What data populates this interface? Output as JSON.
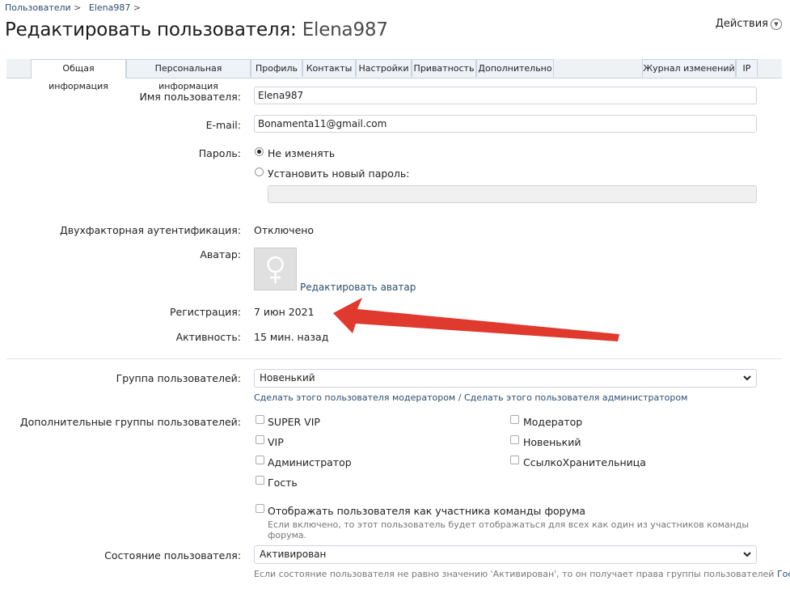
{
  "breadcrumb": {
    "items": [
      "Пользователи",
      "Elena987"
    ]
  },
  "page": {
    "title_prefix": "Редактировать пользователя: ",
    "title_user": "Elena987"
  },
  "actions": {
    "label": "Действия"
  },
  "tabs": {
    "left": [
      "Общая информация",
      "Персональная информация",
      "Профиль",
      "Контакты",
      "Настройки",
      "Приватность",
      "Дополнительно"
    ],
    "right": [
      "Журнал изменений",
      "IP"
    ],
    "active": "Общая информация"
  },
  "form": {
    "username": {
      "label": "Имя пользователя:",
      "value": "Elena987"
    },
    "email": {
      "label": "E-mail:",
      "value": "Bonamenta11@gmail.com"
    },
    "password": {
      "label": "Пароль:",
      "opt_keep": "Не изменять",
      "opt_new": "Установить новый пароль:",
      "selected": "keep"
    },
    "twofa": {
      "label": "Двухфакторная аутентификация:",
      "value": "Отключено"
    },
    "avatar": {
      "label": "Аватар:",
      "edit_link": "Редактировать аватар"
    },
    "registration": {
      "label": "Регистрация:",
      "value": "7 июн 2021"
    },
    "activity": {
      "label": "Активность:",
      "value": "15 мин. назад"
    },
    "group": {
      "label": "Группа пользователей:",
      "value": "Новенький",
      "link_moderator": "Сделать этого пользователя модератором",
      "link_sep": "/",
      "link_admin": "Сделать этого пользователя администратором"
    },
    "extra_groups": {
      "label": "Дополнительные группы пользователей:",
      "col1": [
        "SUPER VIP",
        "VIP",
        "Администратор",
        "Гость"
      ],
      "col2": [
        "Модератор",
        "Новенький",
        "СсылкоХранительница"
      ]
    },
    "staff": {
      "label": "Отображать пользователя как участника команды форума",
      "hint": "Если включено, то этот пользователь будет отображаться для всех как один из участников команды форума."
    },
    "state": {
      "label": "Состояние пользователя:",
      "value": "Активирован",
      "hint": "Если состояние пользователя не равно значению 'Активирован', то он получает права группы пользователей",
      "hint_link": "Гость",
      "hint_end": "."
    }
  },
  "annotation": {
    "arrow_color": "#e03a2f"
  }
}
